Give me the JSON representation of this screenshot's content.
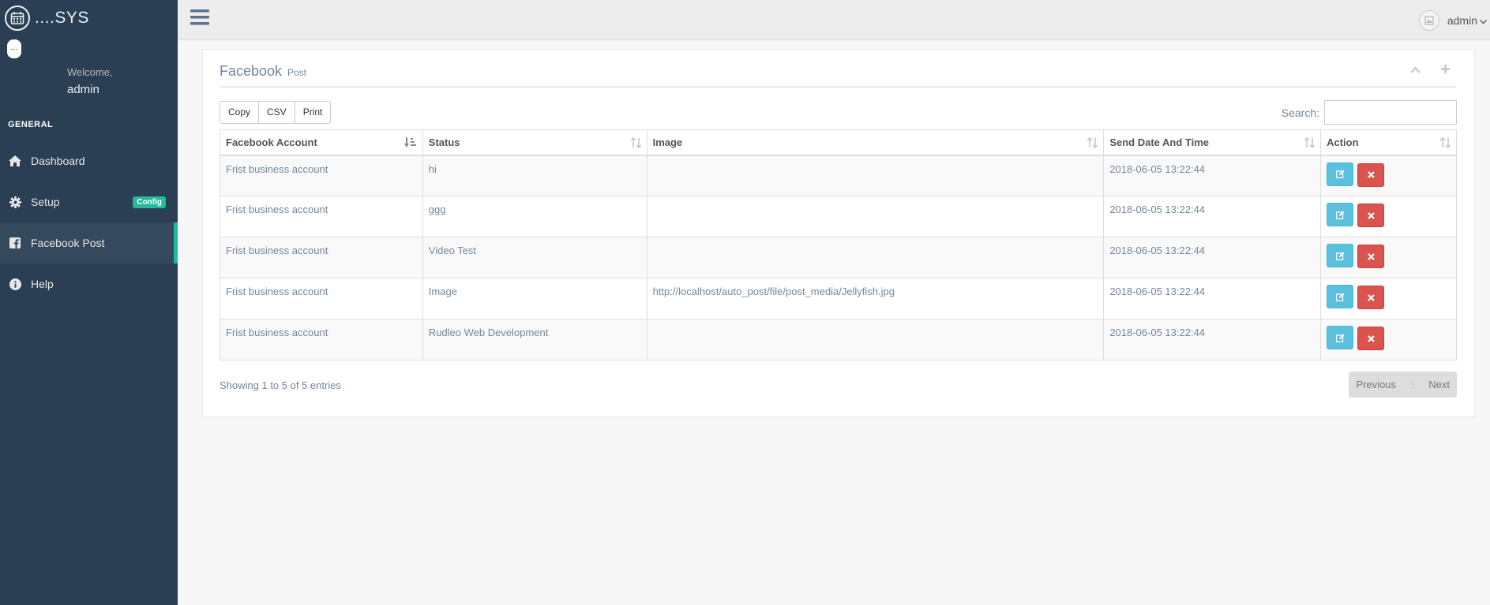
{
  "app": {
    "brand": "....SYS",
    "avatar_text": "..."
  },
  "profile": {
    "welcome": "Welcome,",
    "name": "admin"
  },
  "sidebar": {
    "section": "GENERAL",
    "items": [
      {
        "label": "Dashboard",
        "icon": "home-icon"
      },
      {
        "label": "Setup",
        "icon": "gear-icon",
        "badge": "Config"
      },
      {
        "label": "Facebook Post",
        "icon": "facebook-square-icon",
        "active": true
      },
      {
        "label": "Help",
        "icon": "info-circle-icon"
      }
    ]
  },
  "topnav": {
    "user": "admin"
  },
  "panel": {
    "title": "Facebook",
    "subtitle": "Post"
  },
  "toolbar": {
    "copy_label": "Copy",
    "csv_label": "CSV",
    "print_label": "Print",
    "search_label": "Search:",
    "search_value": ""
  },
  "table": {
    "columns": [
      "Facebook Account",
      "Status",
      "Image",
      "Send Date And Time",
      "Action"
    ],
    "rows": [
      {
        "account": "Frist business account",
        "status": "hi",
        "image": "",
        "datetime": "2018-06-05 13:22:44"
      },
      {
        "account": "Frist business account",
        "status": "ggg",
        "image": "",
        "datetime": "2018-06-05 13:22:44"
      },
      {
        "account": "Frist business account",
        "status": "Video Test",
        "image": "",
        "datetime": "2018-06-05 13:22:44"
      },
      {
        "account": "Frist business account",
        "status": "Image",
        "image": "http://localhost/auto_post/file/post_media/Jellyfish.jpg",
        "datetime": "2018-06-05 13:22:44"
      },
      {
        "account": "Frist business account",
        "status": "Rudleo Web Development",
        "image": "",
        "datetime": "2018-06-05 13:22:44"
      }
    ]
  },
  "footer": {
    "info": "Showing 1 to 5 of 5 entries",
    "previous": "Previous",
    "page": "1",
    "next": "Next"
  },
  "colors": {
    "sidebar_bg": "#2A3F54",
    "active_indicator": "#1ABB9C",
    "badge": "#26B99A",
    "edit_button": "#5BC0DE",
    "delete_button": "#D9534F"
  }
}
